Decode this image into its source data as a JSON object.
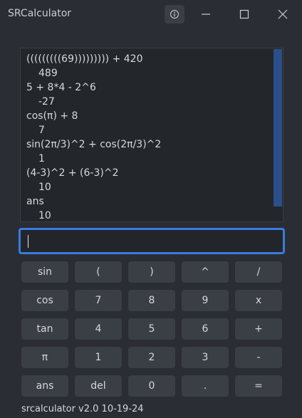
{
  "window": {
    "title": "SRCalculator"
  },
  "history": [
    {
      "text": "(((((((((69)))))))))  + 420",
      "kind": "expr"
    },
    {
      "text": "489",
      "kind": "result"
    },
    {
      "text": "5 + 8*4 - 2^6",
      "kind": "expr"
    },
    {
      "text": "-27",
      "kind": "result"
    },
    {
      "text": "cos(π) + 8",
      "kind": "expr"
    },
    {
      "text": "7",
      "kind": "result"
    },
    {
      "text": "sin(2π/3)^2 + cos(2π/3)^2",
      "kind": "expr"
    },
    {
      "text": "1",
      "kind": "result"
    },
    {
      "text": "(4-3)^2 + (6-3)^2",
      "kind": "expr"
    },
    {
      "text": "10",
      "kind": "result"
    },
    {
      "text": "ans",
      "kind": "expr"
    },
    {
      "text": "10",
      "kind": "result"
    }
  ],
  "input": {
    "value": ""
  },
  "keypad": [
    {
      "label": "sin",
      "name": "key-sin"
    },
    {
      "label": "(",
      "name": "key-open-paren"
    },
    {
      "label": ")",
      "name": "key-close-paren"
    },
    {
      "label": "^",
      "name": "key-power"
    },
    {
      "label": "/",
      "name": "key-divide"
    },
    {
      "label": "cos",
      "name": "key-cos"
    },
    {
      "label": "7",
      "name": "key-7"
    },
    {
      "label": "8",
      "name": "key-8"
    },
    {
      "label": "9",
      "name": "key-9"
    },
    {
      "label": "x",
      "name": "key-multiply"
    },
    {
      "label": "tan",
      "name": "key-tan"
    },
    {
      "label": "4",
      "name": "key-4"
    },
    {
      "label": "5",
      "name": "key-5"
    },
    {
      "label": "6",
      "name": "key-6"
    },
    {
      "label": "+",
      "name": "key-plus"
    },
    {
      "label": "π",
      "name": "key-pi"
    },
    {
      "label": "1",
      "name": "key-1"
    },
    {
      "label": "2",
      "name": "key-2"
    },
    {
      "label": "3",
      "name": "key-3"
    },
    {
      "label": "-",
      "name": "key-minus"
    },
    {
      "label": "ans",
      "name": "key-ans"
    },
    {
      "label": "del",
      "name": "key-del"
    },
    {
      "label": "0",
      "name": "key-0"
    },
    {
      "label": ".",
      "name": "key-decimal"
    },
    {
      "label": "=",
      "name": "key-equals"
    }
  ],
  "footer": {
    "version": "srcalculator v2.0 10-19-24"
  },
  "icons": {
    "info": "info-icon",
    "minimize": "minimize-icon",
    "maximize": "maximize-icon",
    "close": "close-icon"
  },
  "colors": {
    "background": "#2a2d33",
    "accent": "#3a7be0",
    "scrollbar": "#2b4f8a",
    "button": "#3a3e45"
  }
}
